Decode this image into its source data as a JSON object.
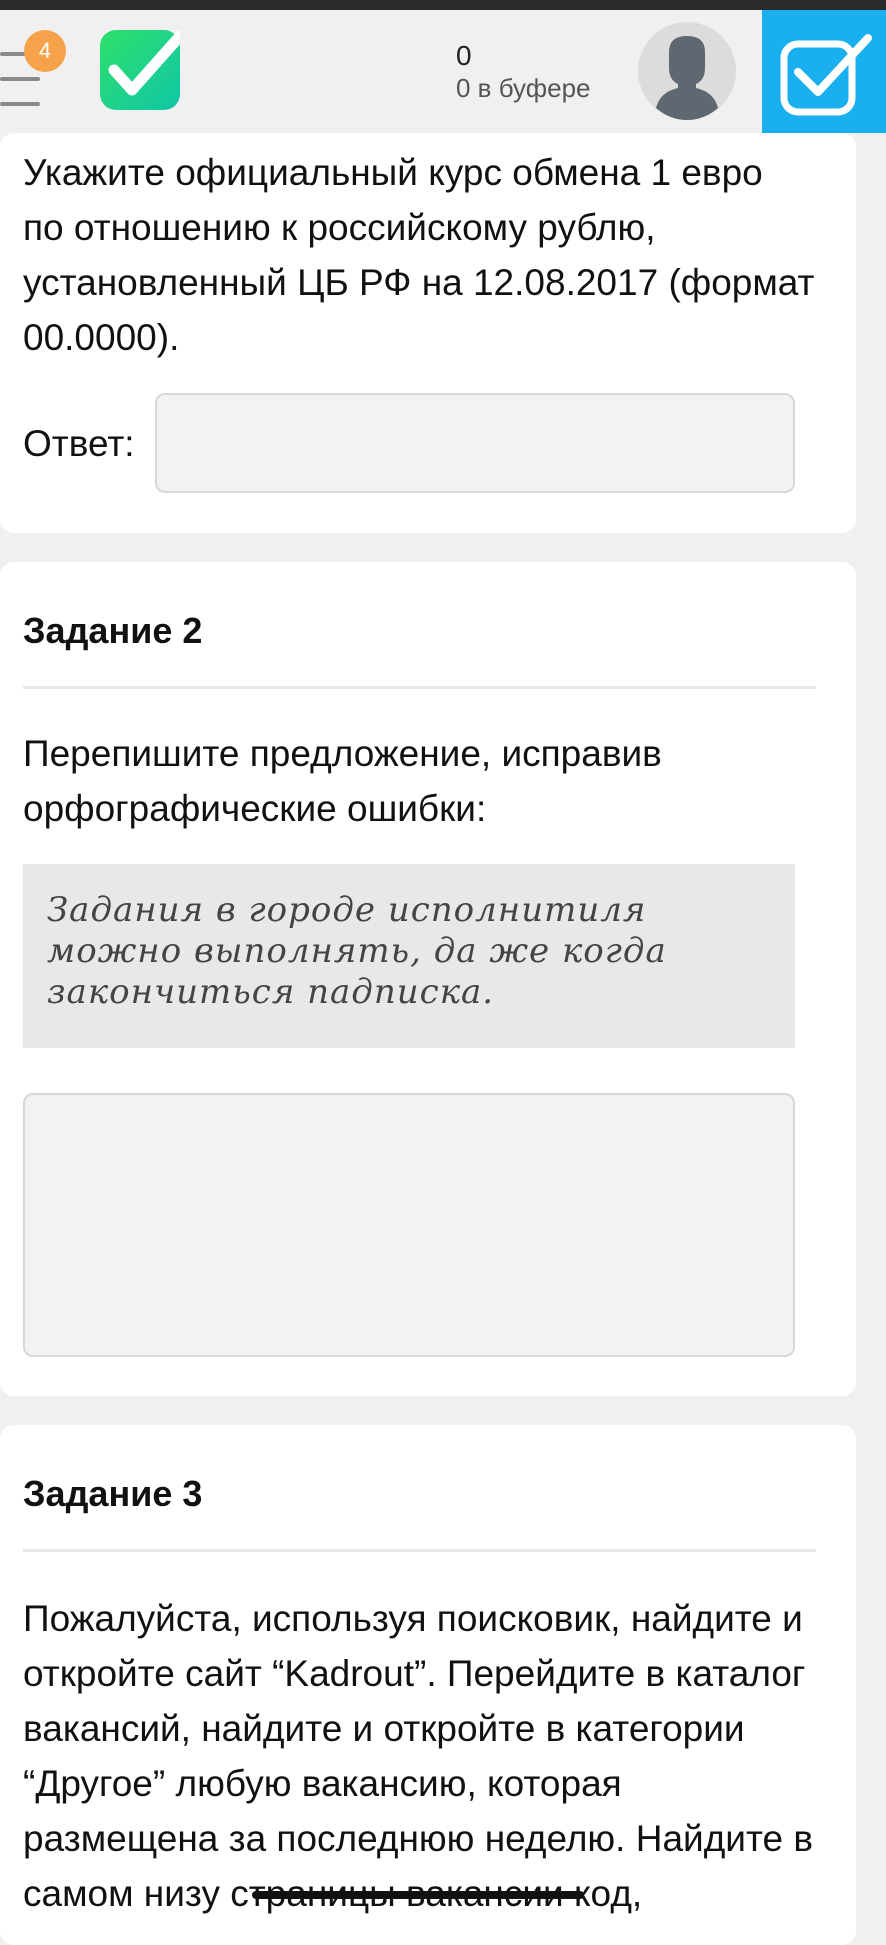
{
  "header": {
    "badge_count": "4",
    "counter_value": "0",
    "counter_label": "0 в буфере",
    "icons": [
      "menu-icon",
      "app-logo-check",
      "avatar-silhouette",
      "checkmark-icon"
    ],
    "colors": {
      "badge": "#f6a24a",
      "logo_gradient": [
        "#27d86b",
        "#13c9a0"
      ],
      "check_button": "#1ab0f0"
    }
  },
  "task1": {
    "question_lines": [
      "Укажите официальный курс обмена 1 евро",
      "по отношению к российскому рублю,",
      "установленный ЦБ РФ на 12.08.2017 (формат",
      "00.0000)."
    ],
    "answer_label": "Ответ:",
    "answer_value": ""
  },
  "task2": {
    "title": "Задание 2",
    "instruction_lines": [
      "Перепишите предложение, исправив",
      "орфографические ошибки:"
    ],
    "quote_lines": [
      "Задания в городе исполнитиля",
      "можно выполнять, да же когда",
      "закончиться падписка."
    ],
    "answer_value": ""
  },
  "task3": {
    "title": "Задание 3",
    "text_lines": [
      "Пожалуйста, используя поисковик, найдите и",
      "откройте сайт “Kadrout”. Перейдите в каталог",
      "вакансий, найдите и откройте в категории",
      "“Другое” любую вакансию, которая",
      "размещена за последнюю неделю. Найдите в",
      "самом низу страницы вакансии код,"
    ]
  }
}
